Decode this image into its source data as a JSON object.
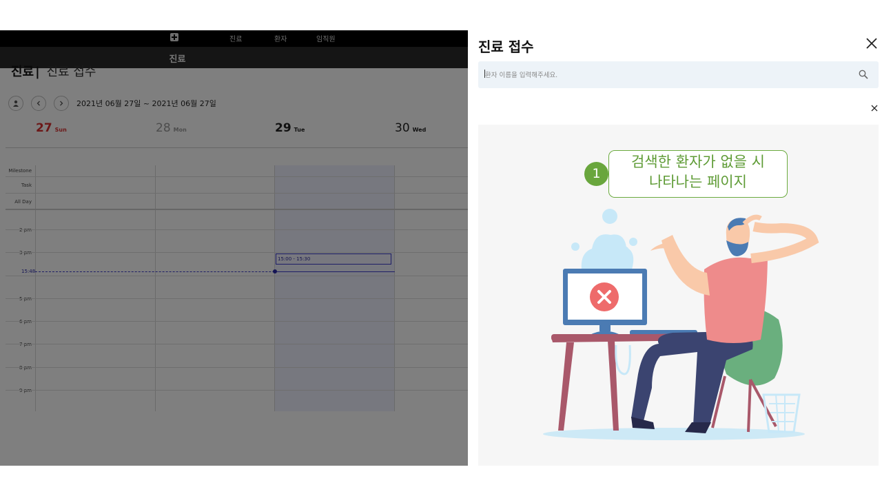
{
  "app": {
    "top_nav": [
      "진료",
      "환자",
      "임직원"
    ],
    "sub_title": "진료",
    "page_title": "진료",
    "page_title_sep": "|",
    "page_subtitle": "진료 접수",
    "date_range": "2021년 06월 27일 ~ 2021년 06월 27일",
    "days": [
      {
        "num": "27",
        "name": "Sun",
        "color": "#d93030"
      },
      {
        "num": "28",
        "name": "Mon",
        "color": "#999999"
      },
      {
        "num": "29",
        "name": "Tue",
        "color": "#111111"
      },
      {
        "num": "30",
        "name": "Wed",
        "color": "#111111"
      }
    ],
    "row_labels": [
      "Milestone",
      "Task",
      "All Day"
    ],
    "hours": [
      "2 pm",
      "3 pm",
      "5 pm",
      "6 pm",
      "7 pm",
      "8 pm",
      "9 pm"
    ],
    "now_label": "15:48",
    "event": "15:00 - 15:30"
  },
  "panel": {
    "title": "진료 접수",
    "search_placeholder": "환자 이름을 입력해주세요.",
    "annotation_number": "1",
    "annotation_line1": "검색한 환자가 없을 시",
    "annotation_line2": "나타나는 페이지"
  },
  "colors": {
    "accent_green": "#69a63d",
    "search_bg": "#edf3f8",
    "event_blue": "#3b3bcc"
  },
  "icons": [
    "plus-icon",
    "user-icon",
    "chevron-left-icon",
    "chevron-right-icon",
    "close-icon",
    "search-icon",
    "error-x-icon"
  ]
}
